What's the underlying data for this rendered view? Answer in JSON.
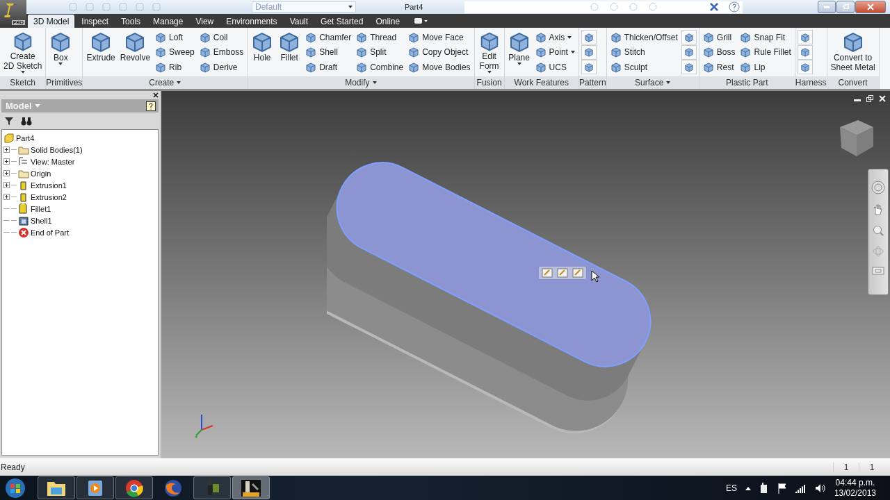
{
  "title_bar": {
    "app_badge": "PRO",
    "style_field": "Default",
    "document": "Part4"
  },
  "tabs": [
    {
      "label": "3D Model",
      "selected": true
    },
    {
      "label": "Inspect",
      "selected": false
    },
    {
      "label": "Tools",
      "selected": false
    },
    {
      "label": "Manage",
      "selected": false
    },
    {
      "label": "View",
      "selected": false
    },
    {
      "label": "Environments",
      "selected": false
    },
    {
      "label": "Vault",
      "selected": false
    },
    {
      "label": "Get Started",
      "selected": false
    },
    {
      "label": "Online",
      "selected": false
    }
  ],
  "ribbon": {
    "panels": [
      {
        "label": "Sketch",
        "menu": false,
        "items": [
          {
            "kind": "large",
            "lines": [
              "Create",
              "2D Sketch"
            ],
            "dropdown": true
          }
        ]
      },
      {
        "label": "Primitives",
        "menu": false,
        "items": [
          {
            "kind": "large",
            "lines": [
              "Box"
            ],
            "dropdown": true
          }
        ]
      },
      {
        "label": "Create",
        "menu": true,
        "items": [
          {
            "kind": "large",
            "lines": [
              "Extrude"
            ],
            "dropdown": false
          },
          {
            "kind": "large",
            "lines": [
              "Revolve"
            ],
            "dropdown": false
          },
          {
            "kind": "small",
            "label": "Loft",
            "dropdown": false
          },
          {
            "kind": "small",
            "label": "Sweep",
            "dropdown": false
          },
          {
            "kind": "small",
            "label": "Rib",
            "dropdown": false
          },
          {
            "kind": "small",
            "label": "Coil",
            "dropdown": false
          },
          {
            "kind": "small",
            "label": "Emboss",
            "dropdown": false
          },
          {
            "kind": "small",
            "label": "Derive",
            "dropdown": false
          }
        ]
      },
      {
        "label": "Modify",
        "menu": true,
        "items": [
          {
            "kind": "large",
            "lines": [
              "Hole"
            ],
            "dropdown": false
          },
          {
            "kind": "large",
            "lines": [
              "Fillet"
            ],
            "dropdown": false
          },
          {
            "kind": "small",
            "label": "Chamfer",
            "dropdown": false
          },
          {
            "kind": "small",
            "label": "Shell",
            "dropdown": false
          },
          {
            "kind": "small",
            "label": "Draft",
            "dropdown": false
          },
          {
            "kind": "small",
            "label": "Thread",
            "dropdown": false
          },
          {
            "kind": "small",
            "label": "Split",
            "dropdown": false
          },
          {
            "kind": "small",
            "label": "Combine",
            "dropdown": false
          },
          {
            "kind": "small",
            "label": "Move Face",
            "dropdown": false
          },
          {
            "kind": "small",
            "label": "Copy Object",
            "dropdown": false
          },
          {
            "kind": "small",
            "label": "Move Bodies",
            "dropdown": false
          }
        ]
      },
      {
        "label": "Fusion",
        "menu": false,
        "items": [
          {
            "kind": "large",
            "lines": [
              "Edit",
              "Form"
            ],
            "dropdown": true
          }
        ]
      },
      {
        "label": "Work Features",
        "menu": false,
        "items": [
          {
            "kind": "large",
            "lines": [
              "Plane"
            ],
            "dropdown": true
          },
          {
            "kind": "small",
            "label": "Axis",
            "dropdown": true
          },
          {
            "kind": "small",
            "label": "Point",
            "dropdown": true
          },
          {
            "kind": "small",
            "label": "UCS",
            "dropdown": false
          }
        ]
      },
      {
        "label": "Pattern",
        "menu": false,
        "items": [
          {
            "kind": "icon"
          },
          {
            "kind": "icon"
          },
          {
            "kind": "icon"
          }
        ]
      },
      {
        "label": "Surface",
        "menu": true,
        "items": [
          {
            "kind": "small",
            "label": "Thicken/Offset",
            "dropdown": false
          },
          {
            "kind": "small",
            "label": "Stitch",
            "dropdown": false
          },
          {
            "kind": "small",
            "label": "Sculpt",
            "dropdown": false
          },
          {
            "kind": "icon"
          },
          {
            "kind": "icon"
          },
          {
            "kind": "icon"
          }
        ]
      },
      {
        "label": "Plastic Part",
        "menu": false,
        "items": [
          {
            "kind": "small",
            "label": "Grill",
            "dropdown": false
          },
          {
            "kind": "small",
            "label": "Boss",
            "dropdown": false
          },
          {
            "kind": "small",
            "label": "Rest",
            "dropdown": false
          },
          {
            "kind": "small",
            "label": "Snap Fit",
            "dropdown": false
          },
          {
            "kind": "small",
            "label": "Rule Fillet",
            "dropdown": false
          },
          {
            "kind": "small",
            "label": "Lip",
            "dropdown": false
          }
        ]
      },
      {
        "label": "Harness",
        "menu": false,
        "items": [
          {
            "kind": "icon"
          },
          {
            "kind": "icon"
          },
          {
            "kind": "icon"
          }
        ]
      },
      {
        "label": "Convert",
        "menu": false,
        "items": [
          {
            "kind": "large",
            "lines": [
              "Convert to",
              "Sheet Metal"
            ],
            "dropdown": false
          }
        ]
      }
    ]
  },
  "browser": {
    "title": "Model",
    "tree": [
      {
        "label": "Part4",
        "kind": "part",
        "expandable": false,
        "children": [
          {
            "label": "Solid Bodies(1)",
            "kind": "bodies",
            "expandable": true
          },
          {
            "label": "View: Master",
            "kind": "view",
            "expandable": true
          },
          {
            "label": "Origin",
            "kind": "folder",
            "expandable": true
          },
          {
            "label": "Extrusion1",
            "kind": "feature",
            "expandable": true
          },
          {
            "label": "Extrusion2",
            "kind": "feature",
            "expandable": true
          },
          {
            "label": "Fillet1",
            "kind": "fillet",
            "expandable": false
          },
          {
            "label": "Shell1",
            "kind": "shell",
            "expandable": false
          },
          {
            "label": "End of Part",
            "kind": "end",
            "expandable": false
          }
        ]
      }
    ]
  },
  "status_bar": {
    "message": "Ready",
    "fields": [
      "1",
      "1"
    ]
  },
  "taskbar": {
    "apps": [
      {
        "kind": "folder",
        "running": true,
        "selected": false
      },
      {
        "kind": "player",
        "running": true,
        "selected": false
      },
      {
        "kind": "browser",
        "running": true,
        "selected": false
      },
      {
        "kind": "globe",
        "running": false,
        "selected": false
      },
      {
        "kind": "device",
        "running": true,
        "selected": false
      },
      {
        "kind": "app",
        "running": true,
        "selected": true
      }
    ],
    "language": "ES",
    "time": "04:44 p.m.",
    "date": "13/02/2013"
  }
}
